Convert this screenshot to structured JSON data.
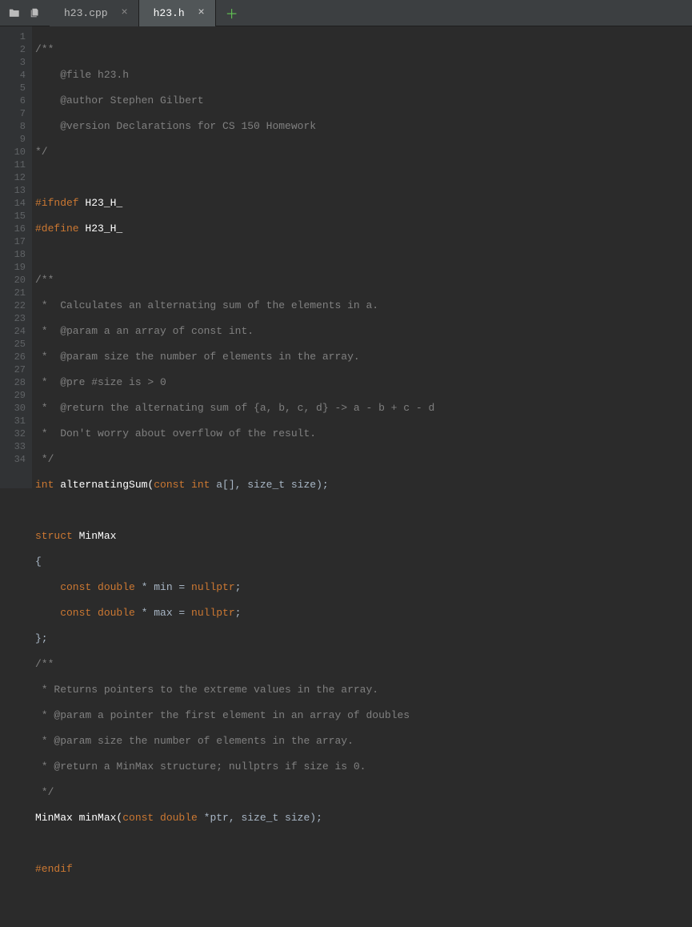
{
  "tabs": {
    "tab1": "h23.cpp",
    "tab2": "h23.h"
  },
  "code": {
    "l1": "/**",
    "l2": "    @file h23.h",
    "l3": "    @author Stephen Gilbert",
    "l4": "    @version Declarations for CS 150 Homework",
    "l5": "*/",
    "l6": "",
    "l7a": "#ifndef ",
    "l7b": "H23_H_",
    "l8a": "#define ",
    "l8b": "H23_H_",
    "l9": "",
    "l10": "/**",
    "l11": " *  Calculates an alternating sum of the elements in a.",
    "l12": " *  @param a an array of const int.",
    "l13": " *  @param size the number of elements in the array.",
    "l14": " *  @pre #size is > 0",
    "l15": " *  @return the alternating sum of {a, b, c, d} -> a - b + c - d",
    "l16": " *  Don't worry about overflow of the result.",
    "l17": " */",
    "l18a": "int",
    "l18b": " alternatingSum(",
    "l18c": "const int",
    "l18d": " a[], size_t size);",
    "l19": "",
    "l20a": "struct",
    "l20b": " MinMax",
    "l21": "{",
    "l22a": "    const double ",
    "l22b": "* min = ",
    "l22c": "nullptr",
    "l22d": ";",
    "l23a": "    const double ",
    "l23b": "* max = ",
    "l23c": "nullptr",
    "l23d": ";",
    "l24": "};",
    "l25": "/**",
    "l26": " * Returns pointers to the extreme values in the array.",
    "l27": " * @param a pointer the first element in an array of doubles",
    "l28": " * @param size the number of elements in the array.",
    "l29": " * @return a MinMax structure; nullptrs if size is 0.",
    "l30": " */",
    "l31a": "MinMax minMax(",
    "l31b": "const double ",
    "l31c": "*ptr, size_t size);",
    "l32": "",
    "l33": "#endif",
    "l34": ""
  },
  "lineNumbers": [
    "1",
    "2",
    "3",
    "4",
    "5",
    "6",
    "7",
    "8",
    "9",
    "10",
    "11",
    "12",
    "13",
    "14",
    "15",
    "16",
    "17",
    "18",
    "19",
    "20",
    "21",
    "22",
    "23",
    "24",
    "25",
    "26",
    "27",
    "28",
    "29",
    "30",
    "31",
    "32",
    "33",
    "34"
  ]
}
